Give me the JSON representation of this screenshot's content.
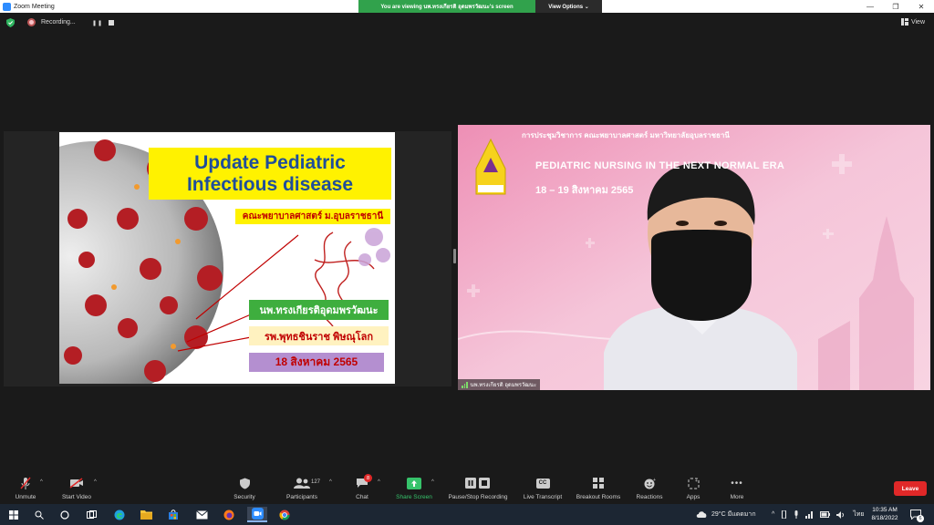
{
  "window": {
    "title": "Zoom Meeting",
    "viewing_banner": "You are viewing นพ.ทรงเกียรติ อุดมพรวัฒนะ's screen",
    "view_options": "View Options ⌄",
    "minimize": "—",
    "restore": "❐",
    "close": "✕"
  },
  "meeting": {
    "recording_status": "Recording...",
    "pause_symbol": "❚❚",
    "view_label": "View"
  },
  "slide": {
    "title_line1": "Update Pediatric",
    "title_line2": "Infectious disease",
    "faculty": "คณะพยาบาลศาสตร์ ม.อุบลราชธานี",
    "speaker_name": "นพ.ทรงเกียรติอุดมพรวัฒนะ",
    "hospital": "รพ.พุทธชินราช พิษณุโลก",
    "date": "18 สิงหาคม 2565"
  },
  "video": {
    "conference_title": "การประชุมวิชาการ คณะพยาบาลศาสตร์ มหาวิทยาลัยอุบลราชธานี",
    "era_title": "PEDIATRIC NURSING IN THE NEXT NORMAL ERA",
    "conference_date": "18 – 19 สิงหาคม 2565",
    "participant_name": "นพ.ทรงเกียรติ อุดมพรวัฒนะ",
    "logo_text": "คณะพยาบาลศาสตร์ มหาวิทยาลัยอุบลราชธานี"
  },
  "toolbar": {
    "unmute": "Unmute",
    "start_video": "Start Video",
    "security": "Security",
    "participants": "Participants",
    "participant_count": "127",
    "chat": "Chat",
    "chat_badge": "8",
    "share_screen": "Share Screen",
    "pause_stop_recording": "Pause/Stop Recording",
    "live_transcript": "Live Transcript",
    "live_transcript_icon_text": "CC",
    "breakout_rooms": "Breakout Rooms",
    "reactions": "Reactions",
    "apps": "Apps",
    "more": "More",
    "leave": "Leave"
  },
  "taskbar": {
    "weather": "29°C มีแดดมาก",
    "language": "ไทย",
    "time": "10:35 AM",
    "date": "8/18/2022",
    "notification_count": "6"
  },
  "colors": {
    "zoom_blue": "#2d8cff",
    "banner_green": "#31a24c",
    "leave_red": "#e02828",
    "slide_yellow": "#fff200",
    "slide_title_blue": "#1f4e9a",
    "video_pink": "#f3c4d8"
  }
}
